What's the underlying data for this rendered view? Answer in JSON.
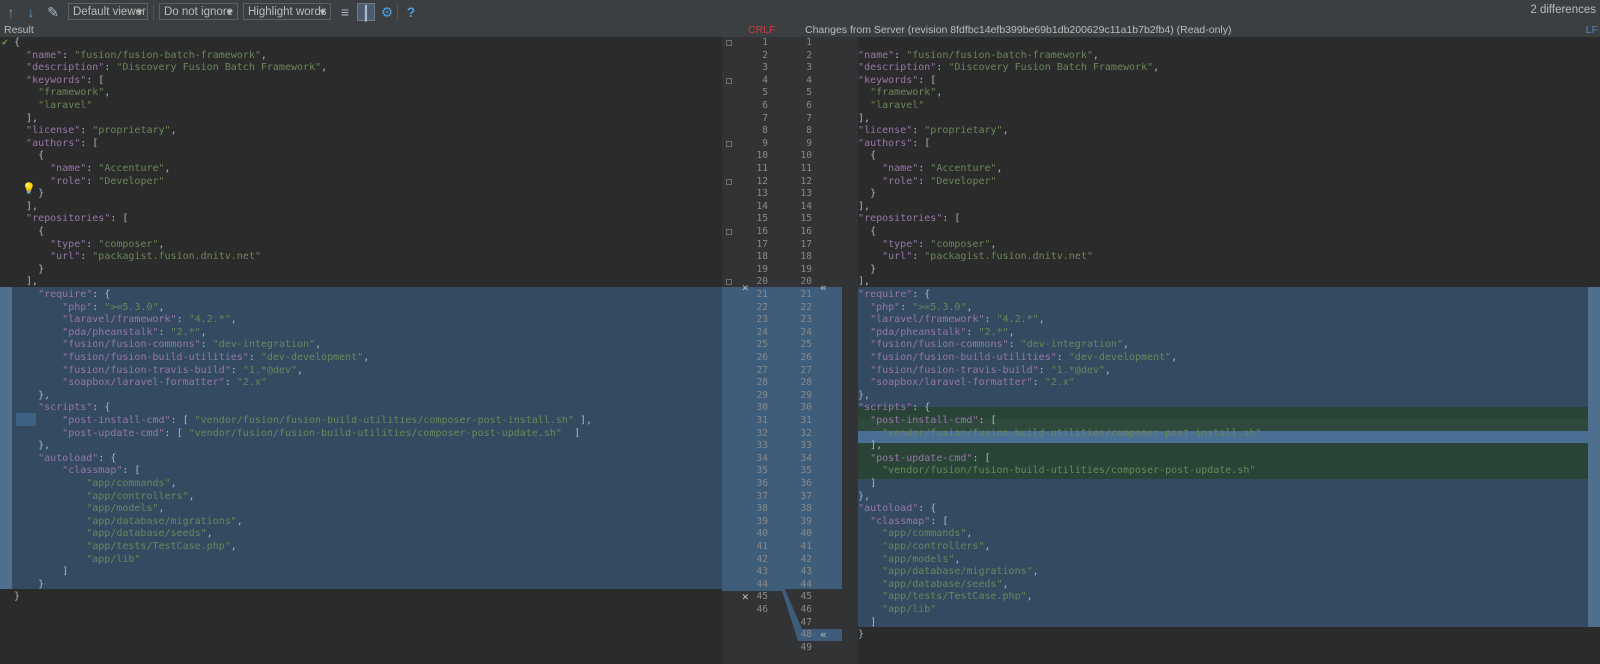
{
  "toolbar": {
    "viewer": "Default viewer",
    "ignore": "Do not ignore",
    "highlight": "Highlight words",
    "diff_count": "2 differences"
  },
  "header": {
    "left_title": "Result",
    "line_sep_left": "CRLF",
    "right_title": "Changes from Server (revision 8fdfbc14efb399be69b1db200629c11a1b7b2fb4) (Read-only)",
    "line_sep_right": "LF"
  },
  "colors": {
    "background": "#2b2b2b",
    "modified": "#344a61",
    "inserted": "#294436",
    "key": "#9876aa",
    "string": "#6a8759",
    "line_sep_left": "#cc3b3b",
    "line_sep_right": "#4a88c7"
  },
  "icons": [
    "prev-diff-arrow-icon",
    "next-diff-arrow-icon",
    "edit-source-icon",
    "collapse-unchanged-icon",
    "sync-scroll-icon",
    "settings-gear-icon",
    "help-icon",
    "apply-left-icon",
    "apply-right-icon",
    "reject-change-icon",
    "lightbulb-icon"
  ],
  "left_lines": [
    [
      [
        "p",
        "{"
      ]
    ],
    [
      [
        "p",
        "  "
      ],
      [
        "k",
        "\"name\""
      ],
      [
        "p",
        ": "
      ],
      [
        "s",
        "\"fusion/fusion-batch-framework\""
      ],
      [
        "p",
        ","
      ]
    ],
    [
      [
        "p",
        "  "
      ],
      [
        "k",
        "\"description\""
      ],
      [
        "p",
        ": "
      ],
      [
        "s",
        "\"Discovery Fusion Batch Framework\""
      ],
      [
        "p",
        ","
      ]
    ],
    [
      [
        "p",
        "  "
      ],
      [
        "k",
        "\"keywords\""
      ],
      [
        "p",
        ": ["
      ]
    ],
    [
      [
        "p",
        "    "
      ],
      [
        "s",
        "\"framework\""
      ],
      [
        "p",
        ","
      ]
    ],
    [
      [
        "p",
        "    "
      ],
      [
        "s",
        "\"laravel\""
      ]
    ],
    [
      [
        "p",
        "  ],"
      ]
    ],
    [
      [
        "p",
        "  "
      ],
      [
        "k",
        "\"license\""
      ],
      [
        "p",
        ": "
      ],
      [
        "s",
        "\"proprietary\""
      ],
      [
        "p",
        ","
      ]
    ],
    [
      [
        "p",
        "  "
      ],
      [
        "k",
        "\"authors\""
      ],
      [
        "p",
        ": ["
      ]
    ],
    [
      [
        "p",
        "    {"
      ]
    ],
    [
      [
        "p",
        "      "
      ],
      [
        "k",
        "\"name\""
      ],
      [
        "p",
        ": "
      ],
      [
        "s",
        "\"Accenture\""
      ],
      [
        "p",
        ","
      ]
    ],
    [
      [
        "p",
        "      "
      ],
      [
        "k",
        "\"role\""
      ],
      [
        "p",
        ": "
      ],
      [
        "s",
        "\"Developer\""
      ]
    ],
    [
      [
        "p",
        "    }"
      ]
    ],
    [
      [
        "p",
        "  ],"
      ]
    ],
    [
      [
        "p",
        "  "
      ],
      [
        "k",
        "\"repositories\""
      ],
      [
        "p",
        ": ["
      ]
    ],
    [
      [
        "p",
        "    {"
      ]
    ],
    [
      [
        "p",
        "      "
      ],
      [
        "k",
        "\"type\""
      ],
      [
        "p",
        ": "
      ],
      [
        "s",
        "\"composer\""
      ],
      [
        "p",
        ","
      ]
    ],
    [
      [
        "p",
        "      "
      ],
      [
        "k",
        "\"url\""
      ],
      [
        "p",
        ": "
      ],
      [
        "s",
        "\"packagist.fusion.dnitv.net\""
      ]
    ],
    [
      [
        "p",
        "    }"
      ]
    ],
    [
      [
        "p",
        "  ],"
      ]
    ],
    [
      [
        "p",
        "    "
      ],
      [
        "k",
        "\"require\""
      ],
      [
        "p",
        ": {"
      ]
    ],
    [
      [
        "p",
        "        "
      ],
      [
        "k",
        "\"php\""
      ],
      [
        "p",
        ": "
      ],
      [
        "s",
        "\">=5.3.0\""
      ],
      [
        "p",
        ","
      ]
    ],
    [
      [
        "p",
        "        "
      ],
      [
        "k",
        "\"laravel/framework\""
      ],
      [
        "p",
        ": "
      ],
      [
        "s",
        "\"4.2.*\""
      ],
      [
        "p",
        ","
      ]
    ],
    [
      [
        "p",
        "        "
      ],
      [
        "k",
        "\"pda/pheanstalk\""
      ],
      [
        "p",
        ": "
      ],
      [
        "s",
        "\"2.*\""
      ],
      [
        "p",
        ","
      ]
    ],
    [
      [
        "p",
        "        "
      ],
      [
        "k",
        "\"fusion/fusion-commons\""
      ],
      [
        "p",
        ": "
      ],
      [
        "s",
        "\"dev-integration\""
      ],
      [
        "p",
        ","
      ]
    ],
    [
      [
        "p",
        "        "
      ],
      [
        "k",
        "\"fusion/fusion-build-utilities\""
      ],
      [
        "p",
        ": "
      ],
      [
        "s",
        "\"dev-development\""
      ],
      [
        "p",
        ","
      ]
    ],
    [
      [
        "p",
        "        "
      ],
      [
        "k",
        "\"fusion/fusion-travis-build\""
      ],
      [
        "p",
        ": "
      ],
      [
        "s",
        "\"1.*@dev\""
      ],
      [
        "p",
        ","
      ]
    ],
    [
      [
        "p",
        "        "
      ],
      [
        "k",
        "\"soapbox/laravel-formatter\""
      ],
      [
        "p",
        ": "
      ],
      [
        "s",
        "\"2.x\""
      ]
    ],
    [
      [
        "p",
        "    },"
      ]
    ],
    [
      [
        "p",
        "    "
      ],
      [
        "k",
        "\"scripts\""
      ],
      [
        "p",
        ": {"
      ]
    ],
    [
      [
        "p",
        "        "
      ],
      [
        "k",
        "\"post-install-cmd\""
      ],
      [
        "p",
        ": [ "
      ],
      [
        "s",
        "\"vendor/fusion/fusion-build-utilities/composer-post-install.sh\""
      ],
      [
        "p",
        " ],"
      ]
    ],
    [
      [
        "p",
        "        "
      ],
      [
        "k",
        "\"post-update-cmd\""
      ],
      [
        "p",
        ": [ "
      ],
      [
        "s",
        "\"vendor/fusion/fusion-build-utilities/composer-post-update.sh\""
      ],
      [
        "p",
        "  ]"
      ]
    ],
    [
      [
        "p",
        "    },"
      ]
    ],
    [
      [
        "p",
        "    "
      ],
      [
        "k",
        "\"autoload\""
      ],
      [
        "p",
        ": {"
      ]
    ],
    [
      [
        "p",
        "        "
      ],
      [
        "k",
        "\"classmap\""
      ],
      [
        "p",
        ": ["
      ]
    ],
    [
      [
        "p",
        "            "
      ],
      [
        "s",
        "\"app/commands\""
      ],
      [
        "p",
        ","
      ]
    ],
    [
      [
        "p",
        "            "
      ],
      [
        "s",
        "\"app/controllers\""
      ],
      [
        "p",
        ","
      ]
    ],
    [
      [
        "p",
        "            "
      ],
      [
        "s",
        "\"app/models\""
      ],
      [
        "p",
        ","
      ]
    ],
    [
      [
        "p",
        "            "
      ],
      [
        "s",
        "\"app/database/migrations\""
      ],
      [
        "p",
        ","
      ]
    ],
    [
      [
        "p",
        "            "
      ],
      [
        "s",
        "\"app/database/seeds\""
      ],
      [
        "p",
        ","
      ]
    ],
    [
      [
        "p",
        "            "
      ],
      [
        "s",
        "\"app/tests/TestCase.php\""
      ],
      [
        "p",
        ","
      ]
    ],
    [
      [
        "p",
        "            "
      ],
      [
        "s",
        "\"app/lib\""
      ]
    ],
    [
      [
        "p",
        "        ]"
      ]
    ],
    [
      [
        "p",
        "    }"
      ]
    ],
    [
      [
        "p",
        "}"
      ]
    ],
    [
      [
        "p",
        ""
      ]
    ]
  ],
  "right_lines": [
    [
      [
        "p",
        "{"
      ]
    ],
    [
      [
        "p",
        "  "
      ],
      [
        "k",
        "\"name\""
      ],
      [
        "p",
        ": "
      ],
      [
        "s",
        "\"fusion/fusion-batch-framework\""
      ],
      [
        "p",
        ","
      ]
    ],
    [
      [
        "p",
        "  "
      ],
      [
        "k",
        "\"description\""
      ],
      [
        "p",
        ": "
      ],
      [
        "s",
        "\"Discovery Fusion Batch Framework\""
      ],
      [
        "p",
        ","
      ]
    ],
    [
      [
        "p",
        "  "
      ],
      [
        "k",
        "\"keywords\""
      ],
      [
        "p",
        ": ["
      ]
    ],
    [
      [
        "p",
        "    "
      ],
      [
        "s",
        "\"framework\""
      ],
      [
        "p",
        ","
      ]
    ],
    [
      [
        "p",
        "    "
      ],
      [
        "s",
        "\"laravel\""
      ]
    ],
    [
      [
        "p",
        "  ],"
      ]
    ],
    [
      [
        "p",
        "  "
      ],
      [
        "k",
        "\"license\""
      ],
      [
        "p",
        ": "
      ],
      [
        "s",
        "\"proprietary\""
      ],
      [
        "p",
        ","
      ]
    ],
    [
      [
        "p",
        "  "
      ],
      [
        "k",
        "\"authors\""
      ],
      [
        "p",
        ": ["
      ]
    ],
    [
      [
        "p",
        "    {"
      ]
    ],
    [
      [
        "p",
        "      "
      ],
      [
        "k",
        "\"name\""
      ],
      [
        "p",
        ": "
      ],
      [
        "s",
        "\"Accenture\""
      ],
      [
        "p",
        ","
      ]
    ],
    [
      [
        "p",
        "      "
      ],
      [
        "k",
        "\"role\""
      ],
      [
        "p",
        ": "
      ],
      [
        "s",
        "\"Developer\""
      ]
    ],
    [
      [
        "p",
        "    }"
      ]
    ],
    [
      [
        "p",
        "  ],"
      ]
    ],
    [
      [
        "p",
        "  "
      ],
      [
        "k",
        "\"repositories\""
      ],
      [
        "p",
        ": ["
      ]
    ],
    [
      [
        "p",
        "    {"
      ]
    ],
    [
      [
        "p",
        "      "
      ],
      [
        "k",
        "\"type\""
      ],
      [
        "p",
        ": "
      ],
      [
        "s",
        "\"composer\""
      ],
      [
        "p",
        ","
      ]
    ],
    [
      [
        "p",
        "      "
      ],
      [
        "k",
        "\"url\""
      ],
      [
        "p",
        ": "
      ],
      [
        "s",
        "\"packagist.fusion.dnitv.net\""
      ]
    ],
    [
      [
        "p",
        "    }"
      ]
    ],
    [
      [
        "p",
        "  ],"
      ]
    ],
    [
      [
        "p",
        "  "
      ],
      [
        "k",
        "\"require\""
      ],
      [
        "p",
        ": {"
      ]
    ],
    [
      [
        "p",
        "    "
      ],
      [
        "k",
        "\"php\""
      ],
      [
        "p",
        ": "
      ],
      [
        "s",
        "\">=5.3.0\""
      ],
      [
        "p",
        ","
      ]
    ],
    [
      [
        "p",
        "    "
      ],
      [
        "k",
        "\"laravel/framework\""
      ],
      [
        "p",
        ": "
      ],
      [
        "s",
        "\"4.2.*\""
      ],
      [
        "p",
        ","
      ]
    ],
    [
      [
        "p",
        "    "
      ],
      [
        "k",
        "\"pda/pheanstalk\""
      ],
      [
        "p",
        ": "
      ],
      [
        "s",
        "\"2.*\""
      ],
      [
        "p",
        ","
      ]
    ],
    [
      [
        "p",
        "    "
      ],
      [
        "k",
        "\"fusion/fusion-commons\""
      ],
      [
        "p",
        ": "
      ],
      [
        "s",
        "\"dev-integration\""
      ],
      [
        "p",
        ","
      ]
    ],
    [
      [
        "p",
        "    "
      ],
      [
        "k",
        "\"fusion/fusion-build-utilities\""
      ],
      [
        "p",
        ": "
      ],
      [
        "s",
        "\"dev-development\""
      ],
      [
        "p",
        ","
      ]
    ],
    [
      [
        "p",
        "    "
      ],
      [
        "k",
        "\"fusion/fusion-travis-build\""
      ],
      [
        "p",
        ": "
      ],
      [
        "s",
        "\"1.*@dev\""
      ],
      [
        "p",
        ","
      ]
    ],
    [
      [
        "p",
        "    "
      ],
      [
        "k",
        "\"soapbox/laravel-formatter\""
      ],
      [
        "p",
        ": "
      ],
      [
        "s",
        "\"2.x\""
      ]
    ],
    [
      [
        "p",
        "  },"
      ]
    ],
    [
      [
        "p",
        "  "
      ],
      [
        "k",
        "\"scripts\""
      ],
      [
        "p",
        ": {"
      ]
    ],
    [
      [
        "p",
        "    "
      ],
      [
        "k",
        "\"post-install-cmd\""
      ],
      [
        "p",
        ": ["
      ]
    ],
    [
      [
        "p",
        "      "
      ],
      [
        "s",
        "\"vendor/fusion/fusion-build-utilities/composer-post-install.sh\""
      ]
    ],
    [
      [
        "p",
        "    ],"
      ]
    ],
    [
      [
        "p",
        "    "
      ],
      [
        "k",
        "\"post-update-cmd\""
      ],
      [
        "p",
        ": ["
      ]
    ],
    [
      [
        "p",
        "      "
      ],
      [
        "s",
        "\"vendor/fusion/fusion-build-utilities/composer-post-update.sh\""
      ]
    ],
    [
      [
        "p",
        "    ]"
      ]
    ],
    [
      [
        "p",
        "  },"
      ]
    ],
    [
      [
        "p",
        "  "
      ],
      [
        "k",
        "\"autoload\""
      ],
      [
        "p",
        ": {"
      ]
    ],
    [
      [
        "p",
        "    "
      ],
      [
        "k",
        "\"classmap\""
      ],
      [
        "p",
        ": ["
      ]
    ],
    [
      [
        "p",
        "      "
      ],
      [
        "s",
        "\"app/commands\""
      ],
      [
        "p",
        ","
      ]
    ],
    [
      [
        "p",
        "      "
      ],
      [
        "s",
        "\"app/controllers\""
      ],
      [
        "p",
        ","
      ]
    ],
    [
      [
        "p",
        "      "
      ],
      [
        "s",
        "\"app/models\""
      ],
      [
        "p",
        ","
      ]
    ],
    [
      [
        "p",
        "      "
      ],
      [
        "s",
        "\"app/database/migrations\""
      ],
      [
        "p",
        ","
      ]
    ],
    [
      [
        "p",
        "      "
      ],
      [
        "s",
        "\"app/database/seeds\""
      ],
      [
        "p",
        ","
      ]
    ],
    [
      [
        "p",
        "      "
      ],
      [
        "s",
        "\"app/tests/TestCase.php\""
      ],
      [
        "p",
        ","
      ]
    ],
    [
      [
        "p",
        "      "
      ],
      [
        "s",
        "\"app/lib\""
      ]
    ],
    [
      [
        "p",
        "    ]"
      ]
    ],
    [
      [
        "p",
        "  }"
      ]
    ],
    [
      [
        "p",
        "}"
      ]
    ]
  ],
  "left_gutter": [
    "1",
    "2",
    "3",
    "4",
    "5",
    "6",
    "7",
    "8",
    "9",
    "10",
    "11",
    "12",
    "13",
    "14",
    "15",
    "16",
    "17",
    "18",
    "19",
    "20",
    "21",
    "22",
    "23",
    "24",
    "25",
    "26",
    "27",
    "28",
    "29",
    "30",
    "31",
    "32",
    "33",
    "34",
    "35",
    "36",
    "37",
    "38",
    "39",
    "40",
    "41",
    "42",
    "43",
    "44",
    "45",
    "46"
  ],
  "right_gutter": [
    "1",
    "2",
    "3",
    "4",
    "5",
    "6",
    "7",
    "8",
    "9",
    "10",
    "11",
    "12",
    "13",
    "14",
    "15",
    "16",
    "17",
    "18",
    "19",
    "20",
    "21",
    "22",
    "23",
    "24",
    "25",
    "26",
    "27",
    "28",
    "29",
    "30",
    "31",
    "32",
    "33",
    "34",
    "35",
    "36",
    "37",
    "38",
    "39",
    "40",
    "41",
    "42",
    "43",
    "44",
    "45",
    "46",
    "47",
    "48",
    "49"
  ]
}
